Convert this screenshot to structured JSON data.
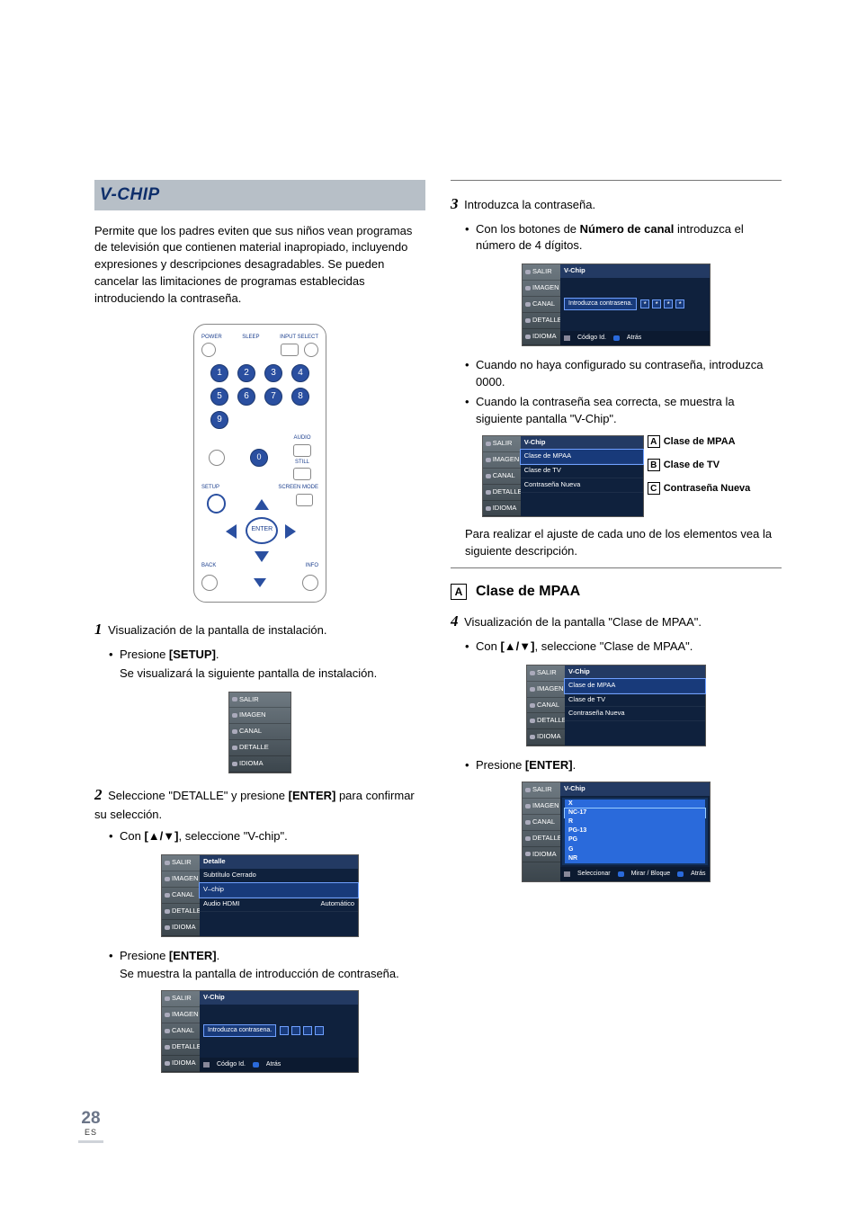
{
  "header": {
    "title": "V-CHIP"
  },
  "left": {
    "intro": "Permite que los padres eviten que sus niños vean programas de televisión que contienen material inapropiado, incluyendo expresiones y descripciones desagradables. Se pueden cancelar las limitaciones de programas establecidas introduciendo la contraseña.",
    "remote": {
      "labels": {
        "power": "POWER",
        "sleep": "SLEEP",
        "input_select": "INPUT SELECT",
        "audio": "AUDIO",
        "still": "STILL",
        "setup": "SETUP",
        "screen_mode": "SCREEN MODE",
        "enter": "ENTER",
        "back": "BACK",
        "info": "INFO"
      },
      "digits": [
        "1",
        "2",
        "3",
        "4",
        "5",
        "6",
        "7",
        "8",
        "9",
        "0"
      ]
    },
    "step1": {
      "text": "Visualización de la pantalla de instalación.",
      "bullet1_pre": "Presione ",
      "bullet1_bold": "[SETUP]",
      "bullet1_post": ".",
      "sub1": "Se visualizará la siguiente pantalla de instalación."
    },
    "step2": {
      "text_pre": "Seleccione \"DETALLE\" y presione ",
      "text_bold": "[ENTER]",
      "text_post": " para confirmar su selección.",
      "bullet1_pre": "Con ",
      "bullet1_bold": "[▲/▼]",
      "bullet1_post": ", seleccione \"V-chip\".",
      "bullet2_pre": "Presione ",
      "bullet2_bold": "[ENTER]",
      "bullet2_post": ".",
      "sub2": "Se muestra la pantalla de introducción de contraseña."
    },
    "osd_sidebar": [
      "SALIR",
      "IMAGEN",
      "CANAL",
      "DETALLE",
      "IDIOMA"
    ],
    "osd_detalle": {
      "title": "Detalle",
      "rows": [
        {
          "l": "Subtítulo Cerrado",
          "r": ""
        },
        {
          "l": "V–chip",
          "r": "",
          "sel": true
        },
        {
          "l": "Audio HDMI",
          "r": "Automático"
        }
      ]
    },
    "osd_vchip_pw": {
      "title": "V-Chip",
      "row_text": "Introduzca contrasena.",
      "status": {
        "a": "Código Id.",
        "b": "Atrás"
      }
    }
  },
  "right": {
    "step3": {
      "text": "Introduzca la contraseña.",
      "bullet1_pre": "Con los botones de ",
      "bullet1_bold": "Número de canal",
      "bullet1_post": " introduzca el número de 4 dígitos.",
      "bullet2": "Cuando no haya configurado su contraseña, introduzca 0000.",
      "bullet3": "Cuando la contraseña sea correcta, se muestra la siguiente pantalla \"V-Chip\"."
    },
    "osd_vchip_stars": {
      "title": "V-Chip",
      "row_text": "Introduzca contrasena.",
      "stars": [
        "*",
        "*",
        "*",
        "*"
      ],
      "status": {
        "a": "Código Id.",
        "b": "Atrás"
      }
    },
    "osd_vchip_menu": {
      "title": "V-Chip",
      "rows": [
        "Clase de MPAA",
        "Clase de TV",
        "Contraseña Nueva"
      ]
    },
    "callouts": {
      "A": "Clase de MPAA",
      "B": "Clase de TV",
      "C": "Contraseña Nueva"
    },
    "after_callouts": "Para realizar el ajuste de cada uno de los elementos vea la siguiente descripción.",
    "subsection_A_title": "Clase de MPAA",
    "step4": {
      "text": "Visualización de la pantalla \"Clase de MPAA\".",
      "bullet1_pre": "Con ",
      "bullet1_bold": "[▲/▼]",
      "bullet1_post": ", seleccione \"Clase de MPAA\".",
      "bullet2_pre": "Presione ",
      "bullet2_bold": "[ENTER]",
      "bullet2_post": "."
    },
    "osd_vchip_menu2": {
      "title": "V-Chip",
      "rows": [
        "Clase de MPAA",
        "Clase de TV",
        "Contraseña Nueva"
      ]
    },
    "osd_ratings": {
      "title": "V-Chip",
      "ratings": [
        "X",
        "NC-17",
        "R",
        "PG-13",
        "PG",
        "G",
        "NR"
      ],
      "status": {
        "a": "Seleccionar",
        "b": "Mirar / Bloque",
        "c": "Atrás"
      }
    }
  },
  "page": {
    "num": "28",
    "lang": "ES"
  }
}
